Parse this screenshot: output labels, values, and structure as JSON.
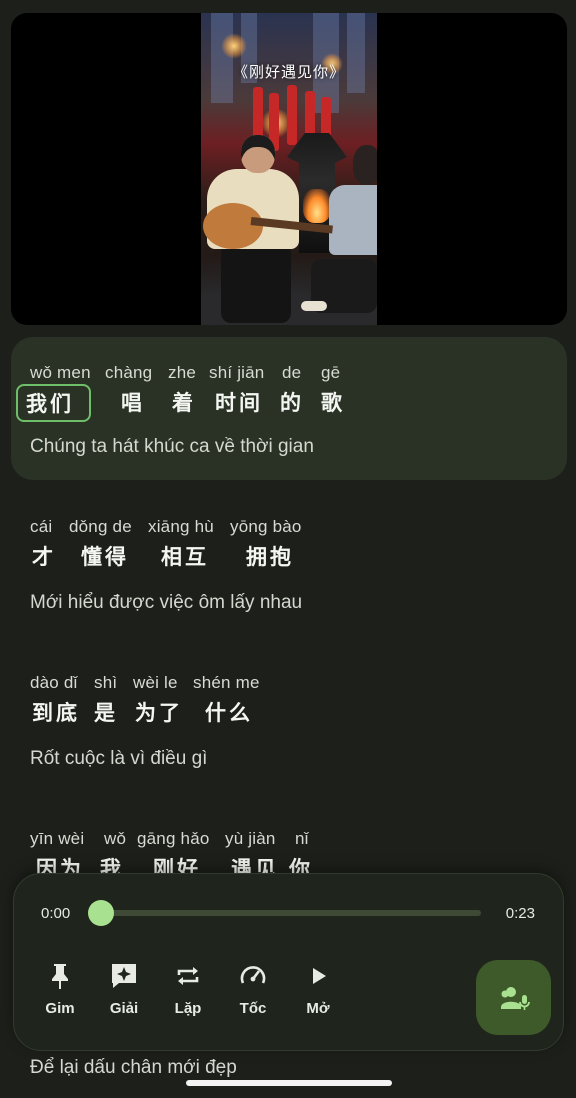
{
  "video": {
    "title_overlay": "《刚好遇见你》"
  },
  "lyrics": [
    {
      "words": [
        {
          "pinyin": "wǒ men",
          "hanzi": "我们"
        },
        {
          "pinyin": "chàng",
          "hanzi": "唱"
        },
        {
          "pinyin": "zhe",
          "hanzi": "着"
        },
        {
          "pinyin": "shí jiān",
          "hanzi": "时间"
        },
        {
          "pinyin": "de",
          "hanzi": "的"
        },
        {
          "pinyin": "gē",
          "hanzi": "歌"
        }
      ],
      "translation": "Chúng ta hát khúc ca về thời gian"
    },
    {
      "words": [
        {
          "pinyin": "cái",
          "hanzi": "才"
        },
        {
          "pinyin": "dǒng de",
          "hanzi": "懂得"
        },
        {
          "pinyin": "xiāng hù",
          "hanzi": "相互"
        },
        {
          "pinyin": "yōng bào",
          "hanzi": "拥抱"
        }
      ],
      "translation": "Mới hiểu được việc ôm lấy nhau"
    },
    {
      "words": [
        {
          "pinyin": "dào dǐ",
          "hanzi": "到底"
        },
        {
          "pinyin": "shì",
          "hanzi": "是"
        },
        {
          "pinyin": "wèi le",
          "hanzi": "为了"
        },
        {
          "pinyin": "shén me",
          "hanzi": "什么"
        }
      ],
      "translation": "Rốt cuộc là vì điều gì"
    },
    {
      "words": [
        {
          "pinyin": "yīn wèi",
          "hanzi": "因为"
        },
        {
          "pinyin": "wǒ",
          "hanzi": "我"
        },
        {
          "pinyin": "gāng hǎo",
          "hanzi": "刚好"
        },
        {
          "pinyin": "yù jiàn",
          "hanzi": "遇见"
        },
        {
          "pinyin": "nǐ",
          "hanzi": "你"
        }
      ]
    },
    {
      "translation": "Để lại dấu chân mới đẹp"
    }
  ],
  "player": {
    "current_time": "0:00",
    "duration": "0:23",
    "progress": 0.0,
    "controls": [
      {
        "icon": "pin-icon",
        "label": "Gim"
      },
      {
        "icon": "sparkle-chat-icon",
        "label": "Giải"
      },
      {
        "icon": "repeat-icon",
        "label": "Lặp"
      },
      {
        "icon": "speedometer-icon",
        "label": "Tốc"
      },
      {
        "icon": "play-icon",
        "label": "Mở"
      }
    ],
    "mic_button_icon": "people-mic-icon"
  },
  "colors": {
    "background": "#1c1f1a",
    "active_block": "#2a3226",
    "accent_green": "#8fdc7e",
    "highlight_border": "#6fbf6a",
    "mic_button": "#3f5a2a"
  }
}
